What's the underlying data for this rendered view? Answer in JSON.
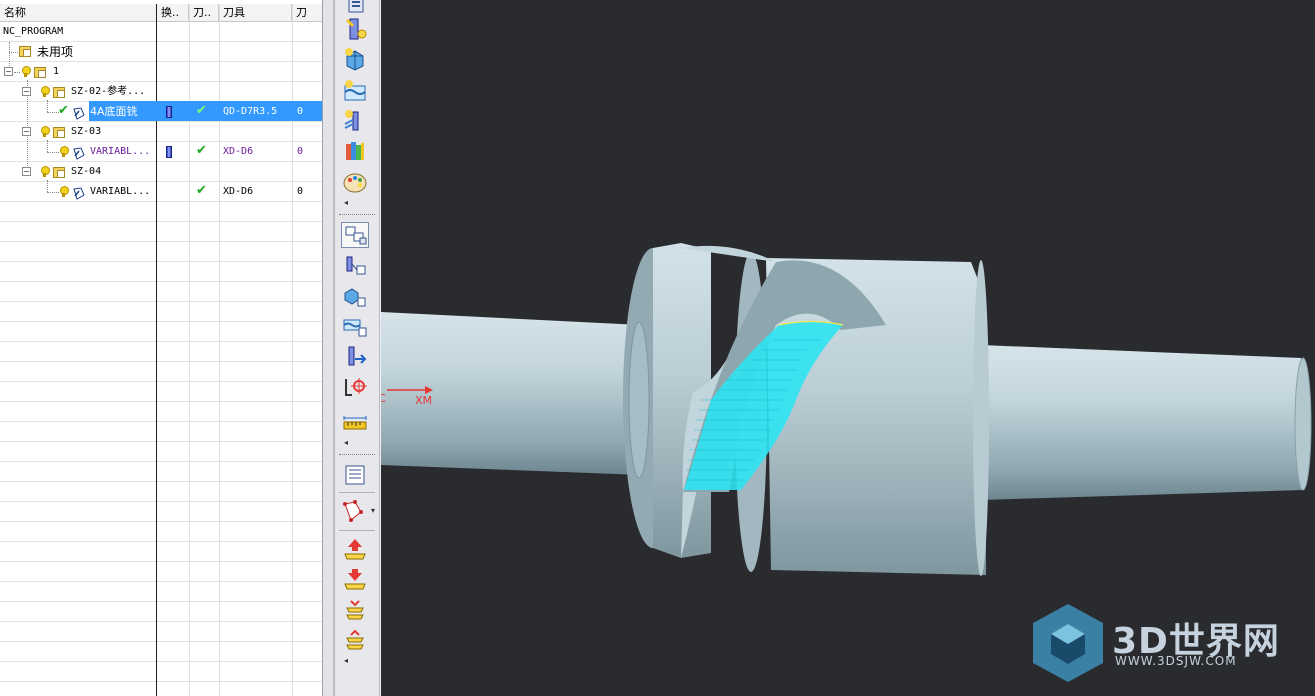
{
  "nav": {
    "columns": [
      "名称",
      "换..",
      "刀..",
      "刀具",
      "刀"
    ],
    "rows": [
      {
        "name": "NC_PROGRAM",
        "tool": "",
        "toolpath": ""
      },
      {
        "name": "未用项",
        "tool": "",
        "toolpath": ""
      },
      {
        "name": "1",
        "tool": "",
        "toolpath": ""
      },
      {
        "name": "SZ-02-参考...",
        "tool": "",
        "toolpath": ""
      },
      {
        "name": "4A底面铣",
        "tool": "QD-D7R3.5",
        "toolpath": "0"
      },
      {
        "name": "SZ-03",
        "tool": "",
        "toolpath": ""
      },
      {
        "name": "VARIABL...",
        "tool": "XD-D6",
        "toolpath": "0"
      },
      {
        "name": "SZ-04",
        "tool": "",
        "toolpath": ""
      },
      {
        "name": "VARIABL...",
        "tool": "XD-D6",
        "toolpath": "0"
      }
    ]
  },
  "toolbar": {
    "icons": [
      "create-program-icon",
      "create-tool-icon",
      "create-geometry-icon",
      "create-method-icon",
      "create-operation-icon",
      "library-icon",
      "palette-icon",
      "program-order-view-icon",
      "machine-tool-view-icon",
      "geometry-view-icon",
      "machining-method-view-icon",
      "tool-sequence-icon",
      "mcs-icon",
      "measure-icon",
      "layer-icon",
      "assembly-icon",
      "move-up-icon",
      "move-down-icon",
      "expand-all-icon",
      "collapse-all-icon"
    ]
  },
  "viewport": {
    "axis_labels": [
      "C",
      "XM"
    ],
    "watermark_title": "3D世界网",
    "watermark_url": "WWW.3DSJW.COM",
    "background": "#2a2b2f",
    "part_color": "#b9cdd4",
    "toolpath_color": "#00e5ff"
  }
}
